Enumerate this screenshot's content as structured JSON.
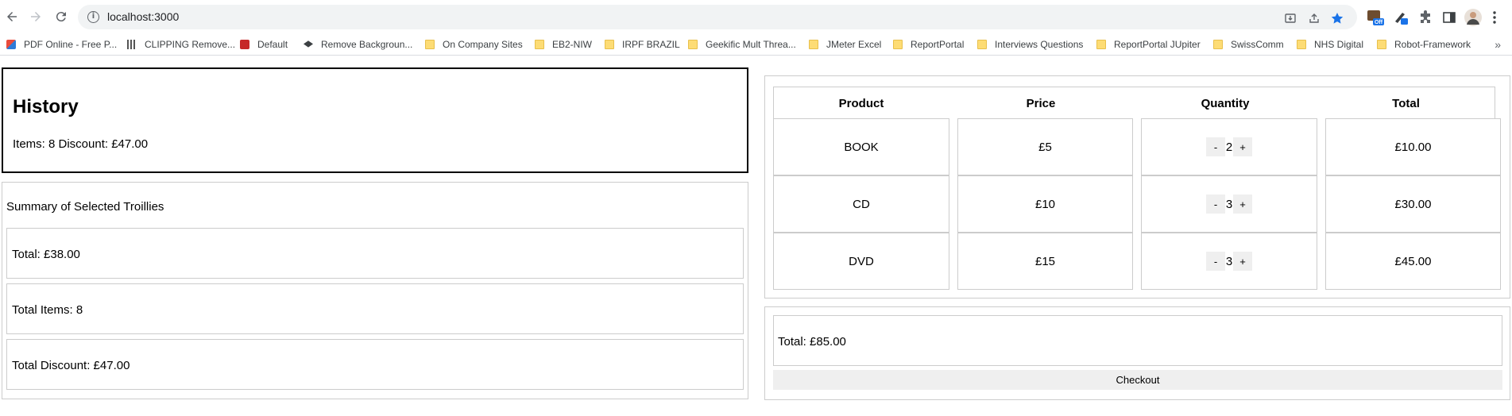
{
  "browser": {
    "url": "localhost:3000",
    "extension_badge": "Off",
    "bookmarks": [
      {
        "label": "PDF Online - Free P...",
        "icon": "pdf-online-icon"
      },
      {
        "label": "CLIPPING Remove...",
        "icon": "clipping-icon"
      },
      {
        "label": "Default",
        "icon": "default-icon"
      },
      {
        "label": "Remove Backgroun...",
        "icon": "remove-bg-icon"
      },
      {
        "label": "On Company Sites",
        "icon": "folder-icon"
      },
      {
        "label": "EB2-NIW",
        "icon": "folder-icon"
      },
      {
        "label": "IRPF BRAZIL",
        "icon": "folder-icon"
      },
      {
        "label": "Geekific Mult Threa...",
        "icon": "folder-icon"
      },
      {
        "label": "JMeter Excel",
        "icon": "folder-icon"
      },
      {
        "label": "ReportPortal",
        "icon": "folder-icon"
      },
      {
        "label": "Interviews Questions",
        "icon": "folder-icon"
      },
      {
        "label": "ReportPortal JUpiter",
        "icon": "folder-icon"
      },
      {
        "label": "SwissComm",
        "icon": "folder-icon"
      },
      {
        "label": "NHS Digital",
        "icon": "folder-icon"
      },
      {
        "label": "Robot-Framework",
        "icon": "folder-icon"
      }
    ],
    "more": "»"
  },
  "history": {
    "title": "History",
    "meta": "Items: 8 Discount: £47.00"
  },
  "summary": {
    "title": "Summary of Selected Troillies",
    "rows": [
      "Total: £38.00",
      "Total Items: 8",
      "Total Discount: £47.00"
    ]
  },
  "cart": {
    "headers": [
      "Product",
      "Price",
      "Quantity",
      "Total"
    ],
    "minus": "-",
    "plus": "+",
    "rows": [
      {
        "product": "BOOK",
        "price": "£5",
        "qty": "2",
        "total": "£10.00"
      },
      {
        "product": "CD",
        "price": "£10",
        "qty": "3",
        "total": "£30.00"
      },
      {
        "product": "DVD",
        "price": "£15",
        "qty": "3",
        "total": "£45.00"
      }
    ],
    "grand_total": "Total: £85.00",
    "checkout_label": "Checkout"
  }
}
